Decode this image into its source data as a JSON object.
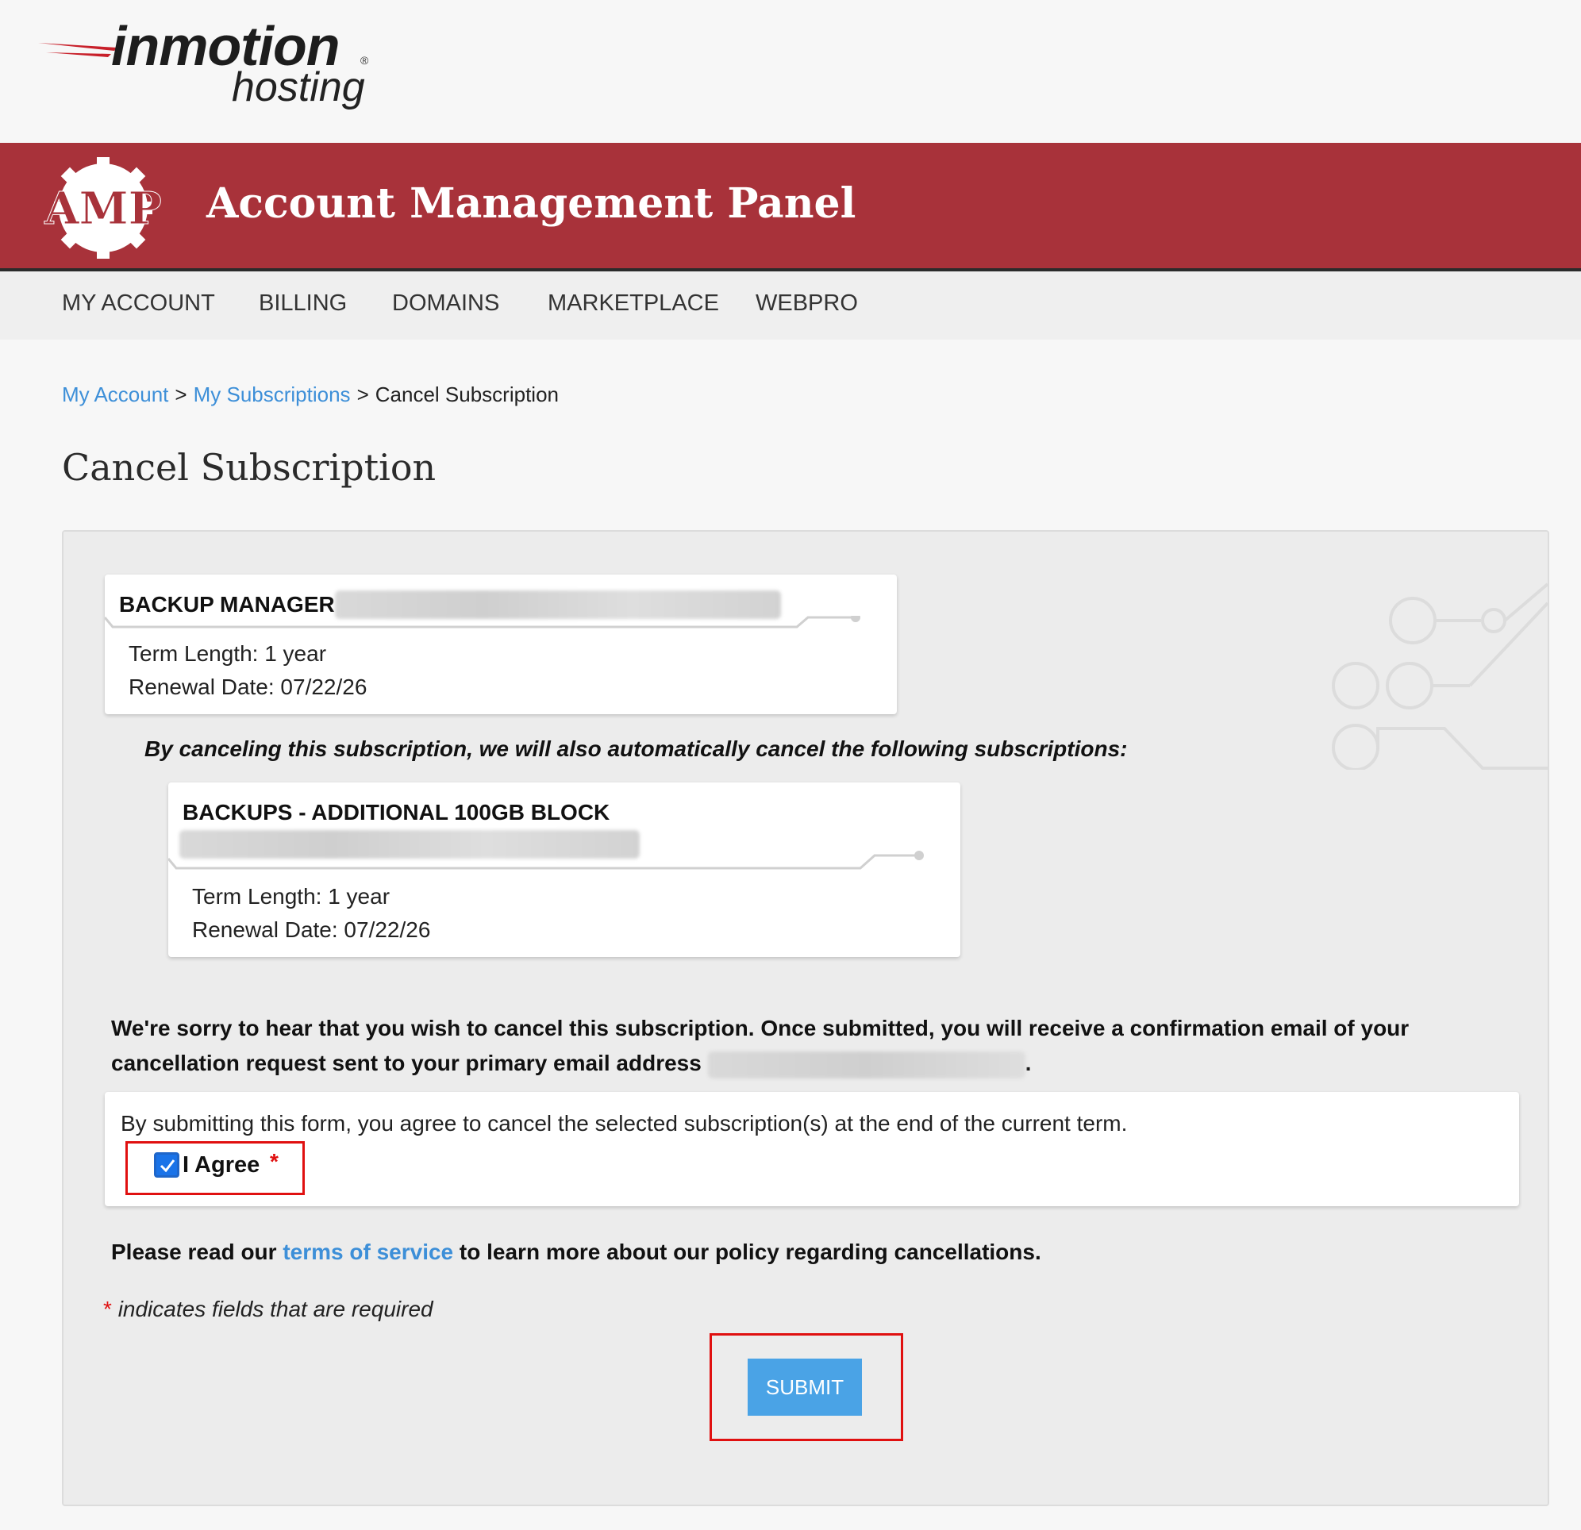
{
  "logo": {
    "word": "inmotion",
    "sub": "hosting",
    "reg": "®"
  },
  "header": {
    "badge": "AMP",
    "title": "Account Management Panel"
  },
  "nav": {
    "items": [
      "MY ACCOUNT",
      "BILLING",
      "DOMAINS",
      "MARKETPLACE",
      "WEBPRO"
    ]
  },
  "breadcrumb": {
    "items": [
      "My Account",
      "My Subscriptions",
      "Cancel Subscription"
    ],
    "separator": ">"
  },
  "page": {
    "title": "Cancel Subscription"
  },
  "primary_subscription": {
    "name": "BACKUP MANAGER",
    "term": "Term Length: 1 year",
    "renewal": "Renewal Date: 07/22/26"
  },
  "also_cancel_note": "By canceling this subscription, we will also automatically cancel the following subscriptions:",
  "dependent_subscription": {
    "name": "BACKUPS - ADDITIONAL 100GB BLOCK",
    "term": "Term Length: 1 year",
    "renewal": "Renewal Date: 07/22/26"
  },
  "sorry": {
    "text": "We're sorry to hear that you wish to cancel this subscription. Once submitted, you will receive a confirmation email of your cancellation request sent to your primary email address",
    "end": "."
  },
  "agreement": {
    "text": "By submitting this form, you agree to cancel the selected subscription(s) at the end of the current term.",
    "label": "I Agree",
    "checked": true,
    "required_mark": "*"
  },
  "tos": {
    "before": "Please read our",
    "link": "terms of service",
    "after": "to learn more about our policy regarding cancellations."
  },
  "required_note": {
    "mark": "*",
    "text": "indicates fields that are required"
  },
  "submit": {
    "label": "SUBMIT"
  },
  "colors": {
    "brand_red": "#a8323a",
    "link_blue": "#3d8fd8",
    "button_blue": "#4aa3e6",
    "highlight_red": "#e01010"
  },
  "icons": [
    "swoosh-logo-icon",
    "gear-badge-icon",
    "circuit-decoration-icon",
    "checkmark-icon"
  ]
}
